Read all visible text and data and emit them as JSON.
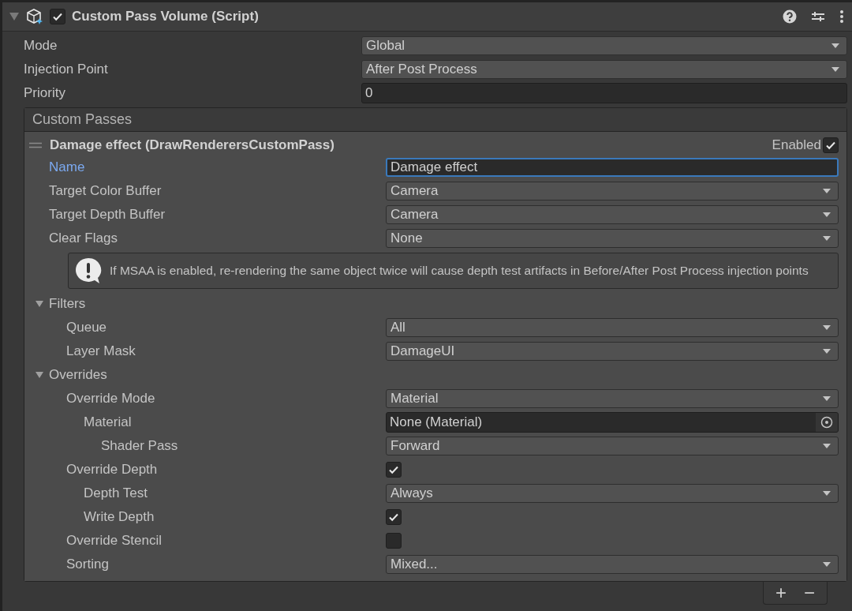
{
  "component": {
    "title": "Custom Pass Volume (Script)",
    "enabled": true,
    "expanded": true
  },
  "fields": [
    {
      "label": "Mode",
      "kind": "dropdown",
      "value": "Global"
    },
    {
      "label": "Injection Point",
      "kind": "dropdown",
      "value": "After Post Process"
    },
    {
      "label": "Priority",
      "kind": "number",
      "value": "0"
    }
  ],
  "custom_passes": {
    "title": "Custom Passes",
    "items": [
      {
        "title": "Damage effect (DrawRenderersCustomPass)",
        "enabled_label": "Enabled",
        "enabled": true,
        "fields": [
          {
            "kind": "text",
            "label": "Name",
            "value": "Damage effect",
            "focused": true
          },
          {
            "kind": "dropdown",
            "label": "Target Color Buffer",
            "value": "Camera"
          },
          {
            "kind": "dropdown",
            "label": "Target Depth Buffer",
            "value": "Camera"
          },
          {
            "kind": "dropdown",
            "label": "Clear Flags",
            "value": "None"
          },
          {
            "kind": "help",
            "text": "If MSAA is enabled, re-rendering the same object twice will cause depth test artifacts in Before/After Post Process injection points"
          },
          {
            "kind": "foldout",
            "label": "Filters",
            "expanded": true,
            "children": [
              {
                "kind": "dropdown",
                "label": "Queue",
                "value": "All"
              },
              {
                "kind": "dropdown",
                "label": "Layer Mask",
                "value": "DamageUI"
              }
            ]
          },
          {
            "kind": "foldout",
            "label": "Overrides",
            "expanded": true,
            "children": [
              {
                "kind": "dropdown",
                "label": "Override Mode",
                "value": "Material",
                "children": [
                  {
                    "kind": "object",
                    "label": "Material",
                    "value": "None (Material)",
                    "children": [
                      {
                        "kind": "dropdown",
                        "label": "Shader Pass",
                        "value": "Forward"
                      }
                    ]
                  }
                ]
              },
              {
                "kind": "checkbox",
                "label": "Override Depth",
                "checked": true,
                "children": [
                  {
                    "kind": "dropdown",
                    "label": "Depth Test",
                    "value": "Always"
                  },
                  {
                    "kind": "checkbox",
                    "label": "Write Depth",
                    "checked": true
                  }
                ]
              },
              {
                "kind": "checkbox",
                "label": "Override Stencil",
                "checked": false
              },
              {
                "kind": "dropdown",
                "label": "Sorting",
                "value": "Mixed..."
              }
            ]
          }
        ]
      }
    ],
    "buttons": [
      "+",
      "−"
    ]
  }
}
